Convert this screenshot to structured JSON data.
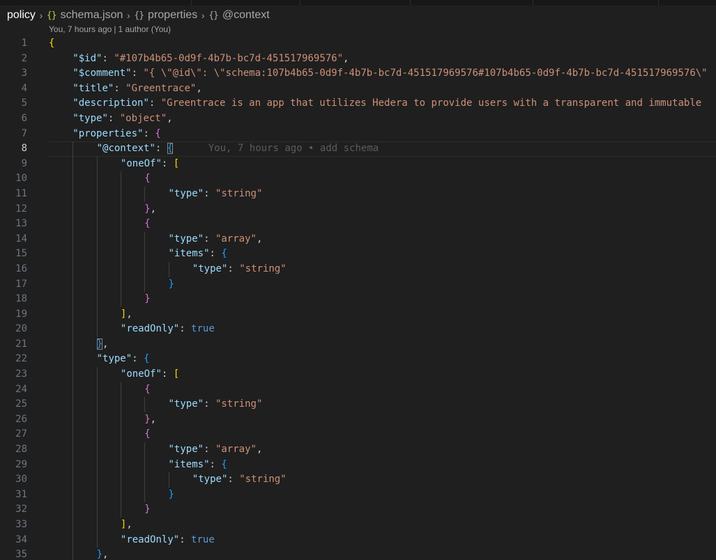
{
  "breadcrumb": {
    "root": "policy",
    "file": "schema.json",
    "file_icon": "{}",
    "seg2": "properties",
    "seg3": "@context",
    "symbol_icon": "{}"
  },
  "codelens": {
    "time": "You, 7 hours ago",
    "separator": "|",
    "authors": "1 author (You)"
  },
  "current_line_blame": "You, 7 hours ago • add schema",
  "editor": {
    "lines": [
      {
        "n": "1",
        "d": 0,
        "t": [
          [
            "b1",
            "{"
          ]
        ]
      },
      {
        "n": "2",
        "d": 1,
        "t": [
          [
            "k",
            "\"$id\""
          ],
          [
            "p",
            ": "
          ],
          [
            "s",
            "\"#107b4b65-0d9f-4b7b-bc7d-451517969576\""
          ],
          [
            "p",
            ","
          ]
        ]
      },
      {
        "n": "3",
        "d": 1,
        "t": [
          [
            "k",
            "\"$comment\""
          ],
          [
            "p",
            ": "
          ],
          [
            "s",
            "\"{ \\\"@id\\\": \\\"schema:107b4b65-0d9f-4b7b-bc7d-451517969576#107b4b65-0d9f-4b7b-bc7d-451517969576\\\""
          ]
        ]
      },
      {
        "n": "4",
        "d": 1,
        "t": [
          [
            "k",
            "\"title\""
          ],
          [
            "p",
            ": "
          ],
          [
            "s",
            "\"Greentrace\""
          ],
          [
            "p",
            ","
          ]
        ]
      },
      {
        "n": "5",
        "d": 1,
        "t": [
          [
            "k",
            "\"description\""
          ],
          [
            "p",
            ": "
          ],
          [
            "s",
            "\"Greentrace is an app that utilizes Hedera to provide users with a transparent and immutable"
          ]
        ]
      },
      {
        "n": "6",
        "d": 1,
        "t": [
          [
            "k",
            "\"type\""
          ],
          [
            "p",
            ": "
          ],
          [
            "s",
            "\"object\""
          ],
          [
            "p",
            ","
          ]
        ]
      },
      {
        "n": "7",
        "d": 1,
        "t": [
          [
            "k",
            "\"properties\""
          ],
          [
            "p",
            ": "
          ],
          [
            "b2",
            "{"
          ]
        ]
      },
      {
        "n": "8",
        "d": 2,
        "current": true,
        "t": [
          [
            "k",
            "\"@context\""
          ],
          [
            "p",
            ": "
          ],
          [
            "b3 bmatch",
            "{"
          ]
        ]
      },
      {
        "n": "9",
        "d": 3,
        "t": [
          [
            "k",
            "\"oneOf\""
          ],
          [
            "p",
            ": "
          ],
          [
            "b1",
            "["
          ]
        ]
      },
      {
        "n": "10",
        "d": 4,
        "t": [
          [
            "b2",
            "{"
          ]
        ]
      },
      {
        "n": "11",
        "d": 5,
        "t": [
          [
            "k",
            "\"type\""
          ],
          [
            "p",
            ": "
          ],
          [
            "s",
            "\"string\""
          ]
        ]
      },
      {
        "n": "12",
        "d": 4,
        "t": [
          [
            "b2",
            "}"
          ],
          [
            "p",
            ","
          ]
        ]
      },
      {
        "n": "13",
        "d": 4,
        "t": [
          [
            "b2",
            "{"
          ]
        ]
      },
      {
        "n": "14",
        "d": 5,
        "t": [
          [
            "k",
            "\"type\""
          ],
          [
            "p",
            ": "
          ],
          [
            "s",
            "\"array\""
          ],
          [
            "p",
            ","
          ]
        ]
      },
      {
        "n": "15",
        "d": 5,
        "t": [
          [
            "k",
            "\"items\""
          ],
          [
            "p",
            ": "
          ],
          [
            "b3",
            "{"
          ]
        ]
      },
      {
        "n": "16",
        "d": 6,
        "t": [
          [
            "k",
            "\"type\""
          ],
          [
            "p",
            ": "
          ],
          [
            "s",
            "\"string\""
          ]
        ]
      },
      {
        "n": "17",
        "d": 5,
        "t": [
          [
            "b3",
            "}"
          ]
        ]
      },
      {
        "n": "18",
        "d": 4,
        "t": [
          [
            "b2",
            "}"
          ]
        ]
      },
      {
        "n": "19",
        "d": 3,
        "t": [
          [
            "b1",
            "]"
          ],
          [
            "p",
            ","
          ]
        ]
      },
      {
        "n": "20",
        "d": 3,
        "t": [
          [
            "k",
            "\"readOnly\""
          ],
          [
            "p",
            ": "
          ],
          [
            "kw",
            "true"
          ]
        ]
      },
      {
        "n": "21",
        "d": 2,
        "t": [
          [
            "b3 bmatch",
            "}"
          ],
          [
            "p",
            ","
          ]
        ]
      },
      {
        "n": "22",
        "d": 2,
        "t": [
          [
            "k",
            "\"type\""
          ],
          [
            "p",
            ": "
          ],
          [
            "b3",
            "{"
          ]
        ]
      },
      {
        "n": "23",
        "d": 3,
        "t": [
          [
            "k",
            "\"oneOf\""
          ],
          [
            "p",
            ": "
          ],
          [
            "b1",
            "["
          ]
        ]
      },
      {
        "n": "24",
        "d": 4,
        "t": [
          [
            "b2",
            "{"
          ]
        ]
      },
      {
        "n": "25",
        "d": 5,
        "t": [
          [
            "k",
            "\"type\""
          ],
          [
            "p",
            ": "
          ],
          [
            "s",
            "\"string\""
          ]
        ]
      },
      {
        "n": "26",
        "d": 4,
        "t": [
          [
            "b2",
            "}"
          ],
          [
            "p",
            ","
          ]
        ]
      },
      {
        "n": "27",
        "d": 4,
        "t": [
          [
            "b2",
            "{"
          ]
        ]
      },
      {
        "n": "28",
        "d": 5,
        "t": [
          [
            "k",
            "\"type\""
          ],
          [
            "p",
            ": "
          ],
          [
            "s",
            "\"array\""
          ],
          [
            "p",
            ","
          ]
        ]
      },
      {
        "n": "29",
        "d": 5,
        "t": [
          [
            "k",
            "\"items\""
          ],
          [
            "p",
            ": "
          ],
          [
            "b3",
            "{"
          ]
        ]
      },
      {
        "n": "30",
        "d": 6,
        "t": [
          [
            "k",
            "\"type\""
          ],
          [
            "p",
            ": "
          ],
          [
            "s",
            "\"string\""
          ]
        ]
      },
      {
        "n": "31",
        "d": 5,
        "t": [
          [
            "b3",
            "}"
          ]
        ]
      },
      {
        "n": "32",
        "d": 4,
        "t": [
          [
            "b2",
            "}"
          ]
        ]
      },
      {
        "n": "33",
        "d": 3,
        "t": [
          [
            "b1",
            "]"
          ],
          [
            "p",
            ","
          ]
        ]
      },
      {
        "n": "34",
        "d": 3,
        "t": [
          [
            "k",
            "\"readOnly\""
          ],
          [
            "p",
            ": "
          ],
          [
            "kw",
            "true"
          ]
        ]
      },
      {
        "n": "35",
        "d": 2,
        "t": [
          [
            "b3",
            "}"
          ],
          [
            "p",
            ","
          ]
        ]
      }
    ]
  }
}
